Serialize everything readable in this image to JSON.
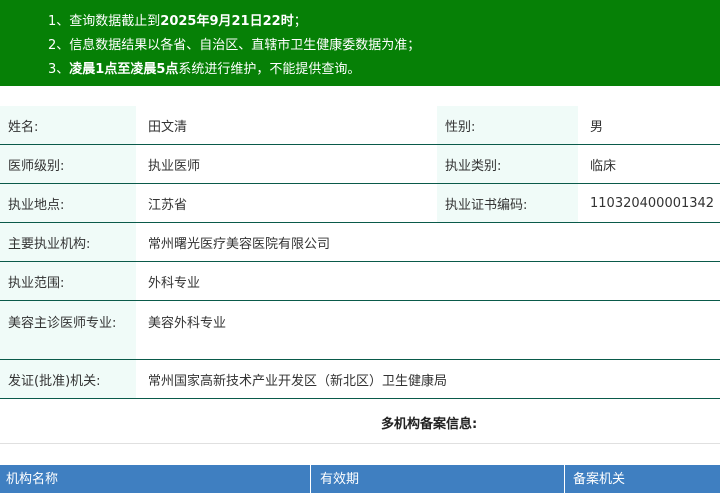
{
  "notice": {
    "line1_prefix": "1、查询数据截止到",
    "line1_bold": "2025年9月21日22时",
    "line1_suffix": "；",
    "line2": "2、信息数据结果以各省、自治区、直辖市卫生健康委数据为准；",
    "line3_prefix": "3、",
    "line3_bold": "凌晨1点至凌晨5点",
    "line3_suffix": "系统进行维护，不能提供查询。"
  },
  "info": {
    "name_label": "姓名:",
    "name_value": "田文清",
    "gender_label": "性别:",
    "gender_value": "男",
    "level_label": "医师级别:",
    "level_value": "执业医师",
    "type_label": "执业类别:",
    "type_value": "临床",
    "location_label": "执业地点:",
    "location_value": "江苏省",
    "cert_label": "执业证书编码:",
    "cert_value": "110320400001342",
    "org_label": "主要执业机构:",
    "org_value": "常州曙光医疗美容医院有限公司",
    "scope_label": "执业范围:",
    "scope_value": "外科专业",
    "cosmetic_label": "美容主诊医师专业:",
    "cosmetic_value": "美容外科专业",
    "issuer_label": "发证(批准)机关:",
    "issuer_value": "常州国家高新技术产业开发区（新北区）卫生健康局"
  },
  "multi_org": {
    "title": "多机构备案信息:",
    "columns": [
      "机构名称",
      "有效期",
      "备案机关"
    ]
  },
  "colors": {
    "notice_bg": "#068006",
    "label_bg": "#f0fbf8",
    "border": "#0a5a4a",
    "table_header_bg": "#3f7fc1"
  }
}
